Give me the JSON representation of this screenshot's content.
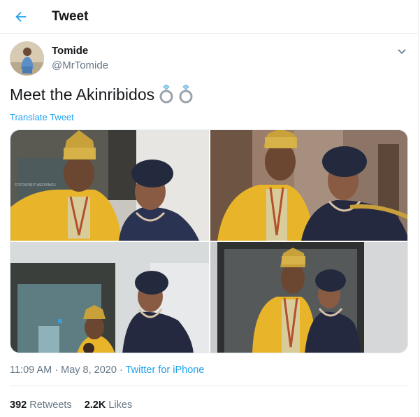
{
  "header": {
    "title": "Tweet",
    "back_icon": "arrow-left-icon"
  },
  "author": {
    "display_name": "Tomide",
    "handle": "@MrTomide"
  },
  "tweet": {
    "text": "Meet the Akinribidos",
    "emoji_icon": "ring-icon",
    "translate_label": "Translate Tweet",
    "time": "11:09 AM",
    "date": "May 8, 2020",
    "source": "Twitter for iPhone",
    "sep": "·"
  },
  "stats": {
    "retweets": "392",
    "retweets_label": "Retweets",
    "likes": "2.2K",
    "likes_label": "Likes"
  },
  "colors": {
    "accent": "#1da1f2",
    "muted": "#657786",
    "text": "#14171a",
    "border": "#e6ecf0"
  }
}
